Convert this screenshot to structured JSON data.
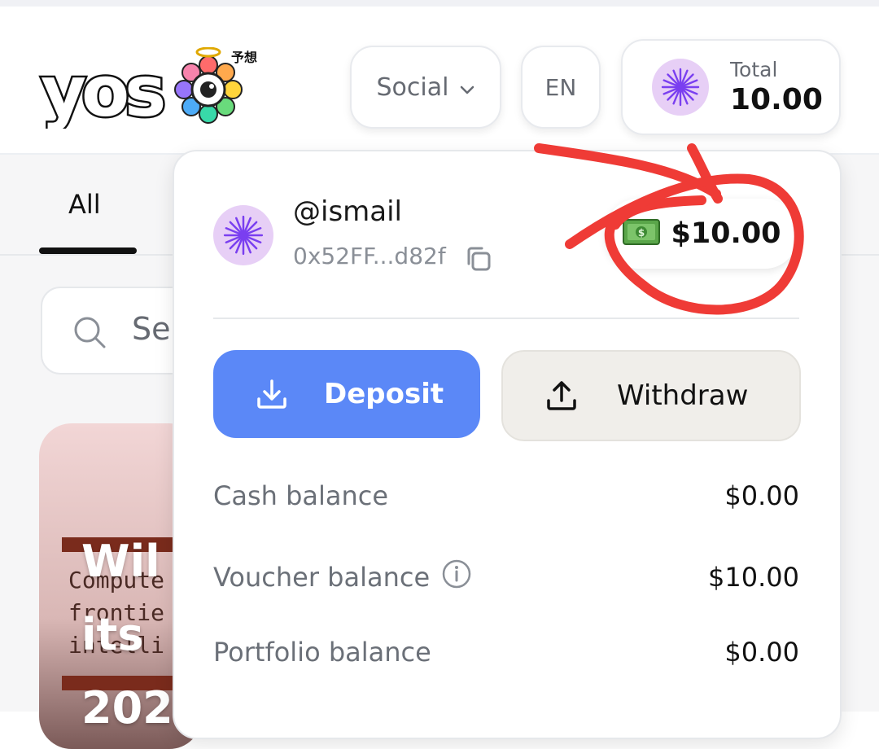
{
  "header": {
    "logo_text": "yoso",
    "logo_kanji": "予想",
    "category_dropdown": {
      "label": "Social",
      "icon": "chevron-down-icon"
    },
    "language_button": {
      "label": "EN"
    },
    "total": {
      "label": "Total",
      "value": "10.00",
      "avatar_icon": "starburst-avatar-icon"
    }
  },
  "page": {
    "tabs": [
      {
        "label": "All",
        "active": true
      }
    ],
    "search": {
      "placeholder": "Se",
      "icon": "search-icon"
    },
    "card": {
      "title_lines": [
        "Wil",
        "its",
        "202"
      ],
      "code_lines": [
        "Compute",
        "frontie",
        "intelli"
      ]
    }
  },
  "wallet_dropdown": {
    "username": "@ismail",
    "address": "0x52FF...d82f",
    "balance_badge": {
      "icon": "dollar-bills-icon",
      "amount": "$10.00"
    },
    "deposit_button": {
      "label": "Deposit",
      "icon": "download-icon"
    },
    "withdraw_button": {
      "label": "Withdraw",
      "icon": "upload-icon"
    },
    "balances": [
      {
        "label": "Cash balance",
        "value": "$0.00"
      },
      {
        "label": "Voucher balance",
        "value": "$10.00",
        "info_icon": true
      },
      {
        "label": "Portfolio balance",
        "value": "$0.00"
      }
    ]
  },
  "colors": {
    "deposit_blue": "#5b88f7",
    "annotation_red": "#ef3b36",
    "avatar_purple": "#7a3ff0",
    "avatar_bg": "#e7cff6"
  }
}
